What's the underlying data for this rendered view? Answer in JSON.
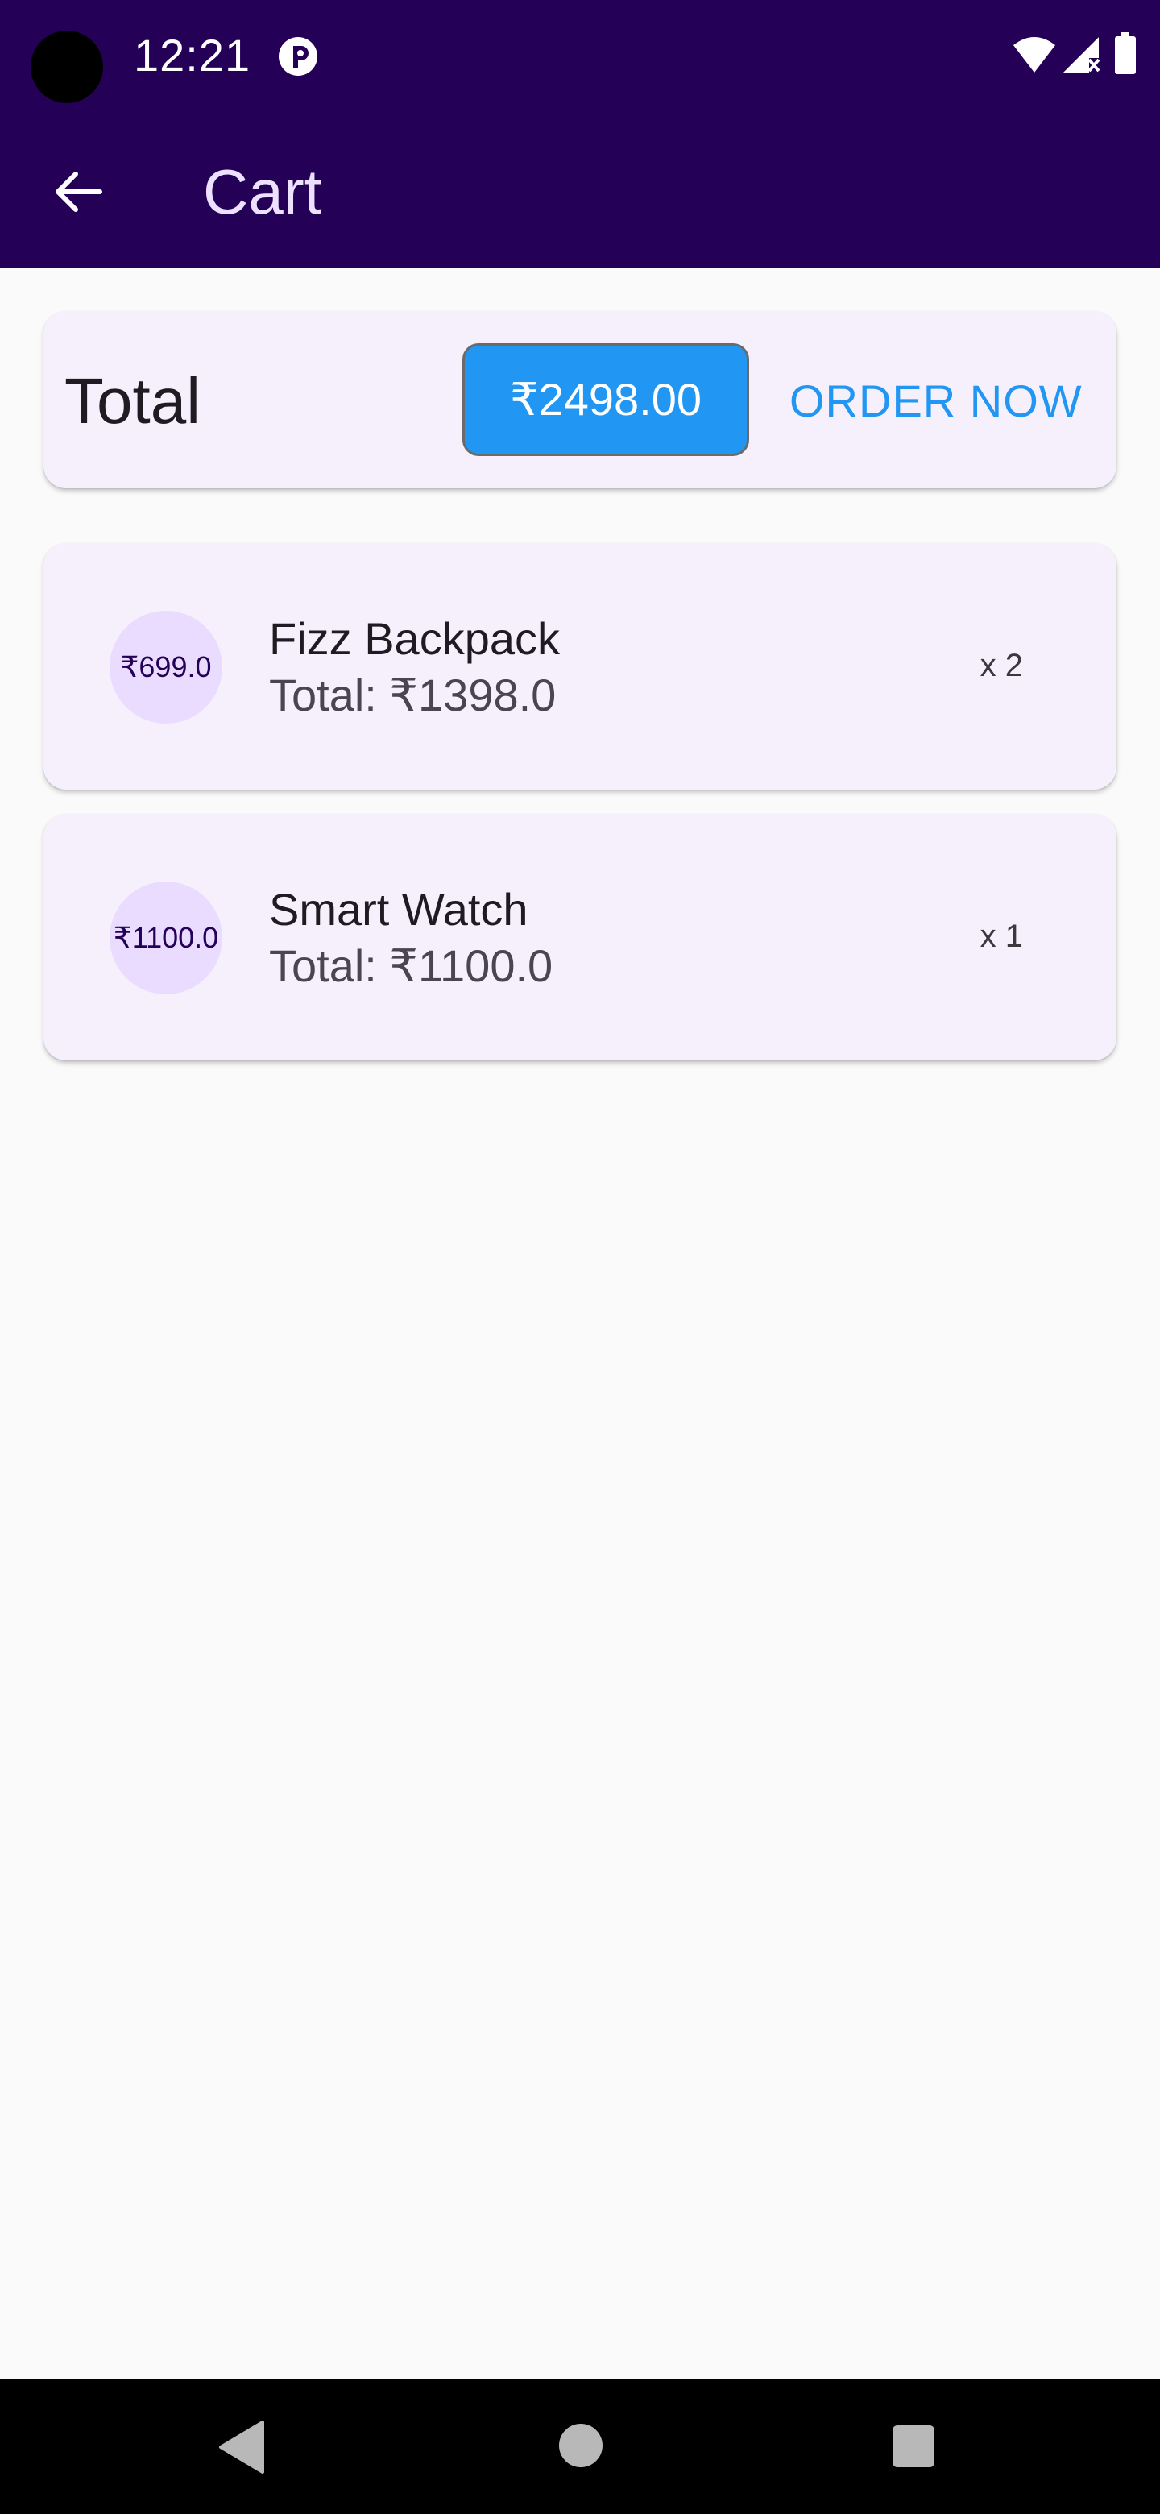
{
  "status_bar": {
    "time": "12:21",
    "background_color": "#250057",
    "icons": [
      "camera-cutout",
      "p-app-icon",
      "wifi-icon",
      "signal-icon",
      "battery-icon"
    ]
  },
  "app_bar": {
    "title": "Cart",
    "back_icon": "arrow-back-icon",
    "background_color": "#250057"
  },
  "summary": {
    "label": "Total",
    "amount": "₹2498.00",
    "order_button_label": "ORDER NOW",
    "accent_color": "#2196f3"
  },
  "cart_items": [
    {
      "name": "Fizz Backpack",
      "price": "₹699.0",
      "subtotal": "Total: ₹1398.0",
      "quantity": "x 2"
    },
    {
      "name": "Smart Watch",
      "price": "₹1100.0",
      "subtotal": "Total: ₹1100.0",
      "quantity": "x 1"
    }
  ],
  "nav_bar": {
    "buttons": [
      "nav-back-icon",
      "nav-home-icon",
      "nav-recents-icon"
    ]
  }
}
